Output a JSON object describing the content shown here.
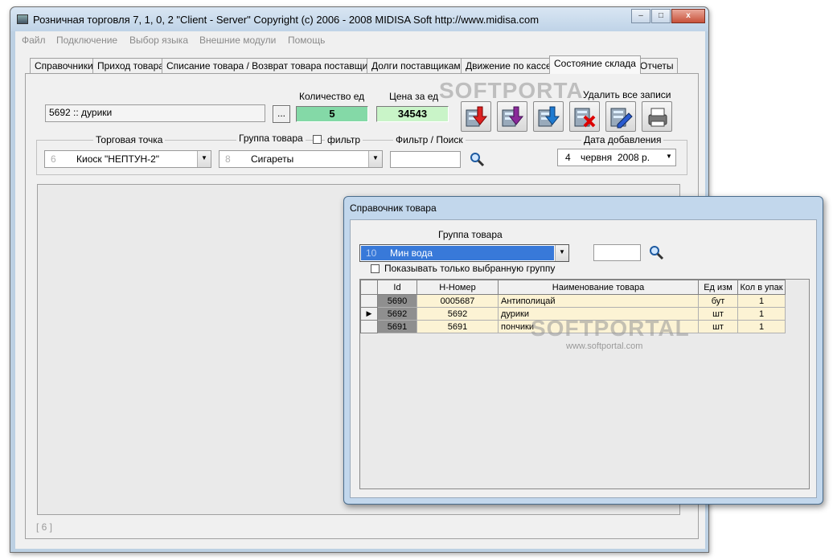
{
  "window": {
    "title": "Розничная торговля 7, 1, 0, 2 \"Client - Server\" Copyright (c) 2006 - 2008 MIDISA Soft http://www.midisa.com",
    "caption_buttons": {
      "minimize": "–",
      "maximize": "□",
      "close": "x"
    }
  },
  "menu": [
    "Файл",
    "Подключение",
    "Выбор языка",
    "Внешние модули",
    "Помощь"
  ],
  "tabs": [
    "Справочники",
    "Приход товара",
    "Списание товара / Возврат товара поставщику",
    "Долги поставщикам",
    "Движение по кассе",
    "Состояние склада",
    "Отчеты"
  ],
  "active_tab": "Состояние склада",
  "product": {
    "value": "5692 :: дурики",
    "browse_label": "...",
    "qty_label": "Количество ед",
    "qty_value": "5",
    "price_label": "Цена за ед",
    "price_value": "34543",
    "delete_all_label": "Удалить все записи"
  },
  "filters": {
    "point_label": "Торговая точка",
    "point_code": "6",
    "point_name": "Киоск \"НЕПТУН-2\"",
    "group_label": "Группа товара",
    "group_code": "8",
    "group_name": "Сигареты",
    "filter_checkbox_label": "фильтр",
    "search_label": "Фильтр / Поиск",
    "search_value": "",
    "date_label": "Дата добавления",
    "date_day": "4",
    "date_month": "червня",
    "date_year": "2008 р."
  },
  "status": "[ 6 ]",
  "dialog": {
    "title": "Справочник товара",
    "group_label": "Группа товара",
    "group_code": "10",
    "group_name": "Мин вода",
    "search_value": "",
    "only_selected_label": "Показывать только выбранную группу",
    "columns": [
      "Id",
      "Н-Номер",
      "Наименование товара",
      "Ед изм",
      "Кол в упак"
    ],
    "rows": [
      {
        "id": "5690",
        "num": "0005687",
        "name": "Антиполицай",
        "unit": "бут",
        "pack": "1",
        "current": false
      },
      {
        "id": "5692",
        "num": "5692",
        "name": "дурики",
        "unit": "шт",
        "pack": "1",
        "current": true
      },
      {
        "id": "5691",
        "num": "5691",
        "name": "пончики",
        "unit": "шт",
        "pack": "1",
        "current": false
      }
    ]
  },
  "watermarks": {
    "brand": "SOFTPORTAL",
    "brand_short": "SOFTPORTA",
    "url": "www.softportal.com"
  },
  "colors": {
    "qty_bg": "#84d9a7",
    "price_bg": "#c9f4c8",
    "row_bg": "#fcf3d4",
    "select_bg": "#3879d9"
  }
}
